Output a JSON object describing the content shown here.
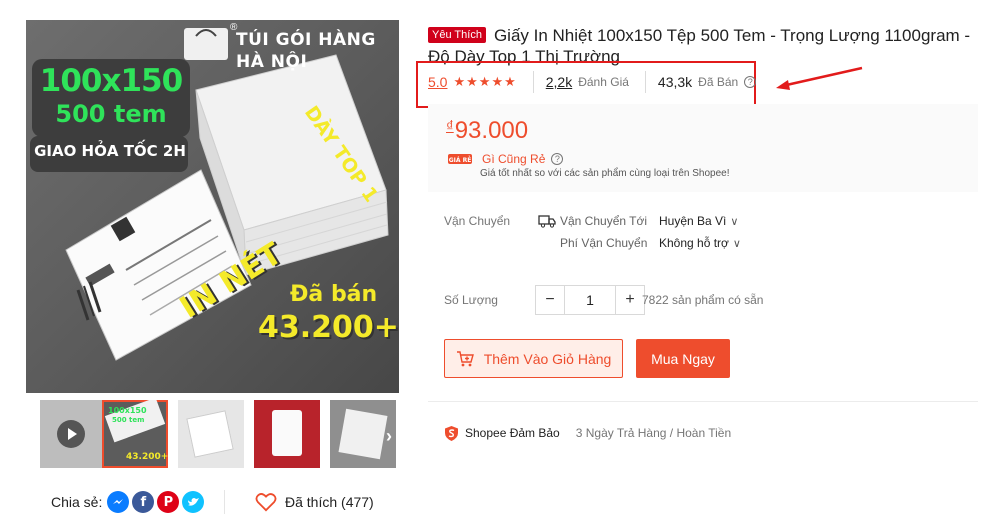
{
  "gallery": {
    "brand_line1": "TÚI GÓI HÀNG",
    "brand_line2": "HÀ NỘI",
    "brand_mark": "®",
    "size_text": "100x150",
    "count_text": "500 tem",
    "shipping_text": "GIAO HỎA TỐC 2H",
    "slogan_top": "DÀY TOP 1",
    "slogan_print": "IN NÉT",
    "sold_label": "Đã bán",
    "sold_value": "43.200+",
    "thumb_next": "›",
    "thumb_overlay": {
      "line1": "100x150",
      "line2": "500 tem",
      "line3": "43.200+"
    }
  },
  "share": {
    "label": "Chia sẻ:",
    "icons": [
      "messenger-icon",
      "facebook-icon",
      "pinterest-icon",
      "twitter-icon"
    ]
  },
  "favorite": {
    "label": "Đã thích (477)"
  },
  "product": {
    "badge": "Yêu Thích",
    "title": "Giấy In Nhiệt 100x150 Tệp 500 Tem - Trọng Lượng 1100gram - Độ Dày Top 1 Thị Trường",
    "rating": "5.0",
    "stars": 5,
    "reviews_count": "2,2k",
    "reviews_label": "Đánh Giá",
    "sold_count": "43,3k",
    "sold_label": "Đã Bán",
    "help_glyph": "?"
  },
  "price": {
    "currency": "₫",
    "value": "93.000",
    "cheap_title": "Gì Cũng Rẻ",
    "cheap_desc": "Giá tốt nhất so với các sản phẩm cùng loại trên Shopee!",
    "cheap_icon_text": "GIÁ RẺ"
  },
  "shipping": {
    "label": "Vận Chuyển",
    "to_label": "Vận Chuyển Tới",
    "to_value": "Huyện Ba Vì",
    "fee_label": "Phí Vận Chuyển",
    "fee_value": "Không hỗ trợ"
  },
  "quantity": {
    "label": "Số Lượng",
    "minus": "−",
    "value": "1",
    "plus": "+",
    "stock": "7822 sản phẩm có sẵn"
  },
  "actions": {
    "add_to_cart": "Thêm Vào Giỏ Hàng",
    "buy_now": "Mua Ngay"
  },
  "guarantee": {
    "title": "Shopee Đảm Bảo",
    "desc": "3 Ngày Trả Hàng / Hoàn Tiền"
  },
  "colors": {
    "accent": "#ee4d2d",
    "highlight_border": "#e21b1b",
    "badge_red": "#d0011b",
    "promo_green": "#2fe35a",
    "promo_yellow": "#f4ea2a"
  }
}
